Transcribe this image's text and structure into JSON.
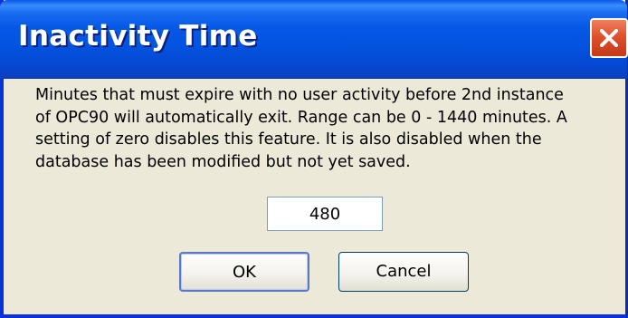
{
  "dialog": {
    "title": "Inactivity Time",
    "close_icon": "close-icon",
    "message_lines": [
      "Minutes that must expire with no user activity before 2nd instance",
      "of OPC90 will automatically exit. Range can be 0 - 1440 minutes. A",
      "setting of zero disables this feature. It is also disabled when the",
      "database has been modified but not yet saved."
    ],
    "input_value": "480",
    "ok_label": "OK",
    "cancel_label": "Cancel"
  },
  "colors": {
    "titlebar": "#0558e6",
    "window_body": "#ece9d8",
    "close_button": "#e0502c"
  }
}
